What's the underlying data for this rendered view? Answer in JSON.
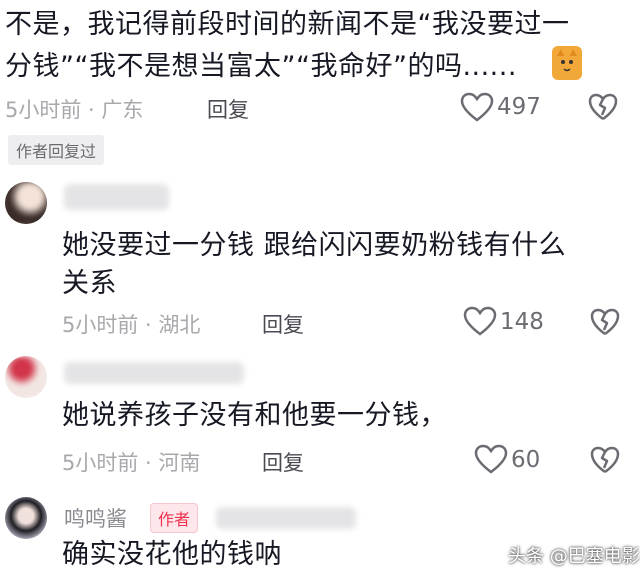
{
  "top_comment": {
    "line1": "不是，我记得前段时间的新闻不是“我没要过一",
    "line2": "分钱”“我不是想当富太”“我命好”的吗......",
    "meta": "5小时前 · 广东",
    "reply_label": "回复",
    "likes": "497",
    "author_tag": "作者回复过"
  },
  "comments": [
    {
      "text_line1": "她没要过一分钱 跟给闪闪要奶粉钱有什么",
      "text_line2": "关系",
      "meta": "5小时前 · 湖北",
      "reply_label": "回复",
      "likes": "148"
    },
    {
      "text_line1": "她说养孩子没有和他要一分钱，",
      "meta": "5小时前 · 河南",
      "reply_label": "回复",
      "likes": "60"
    },
    {
      "username": "鸣鸣酱",
      "author_badge": "作者",
      "text_line1": "确实没花他的钱呐"
    }
  ],
  "watermark": "头条 @巴塞电影",
  "colors": {
    "author_red": "#f0314e",
    "meta_gray": "#a8a9ad",
    "text": "#161823"
  }
}
